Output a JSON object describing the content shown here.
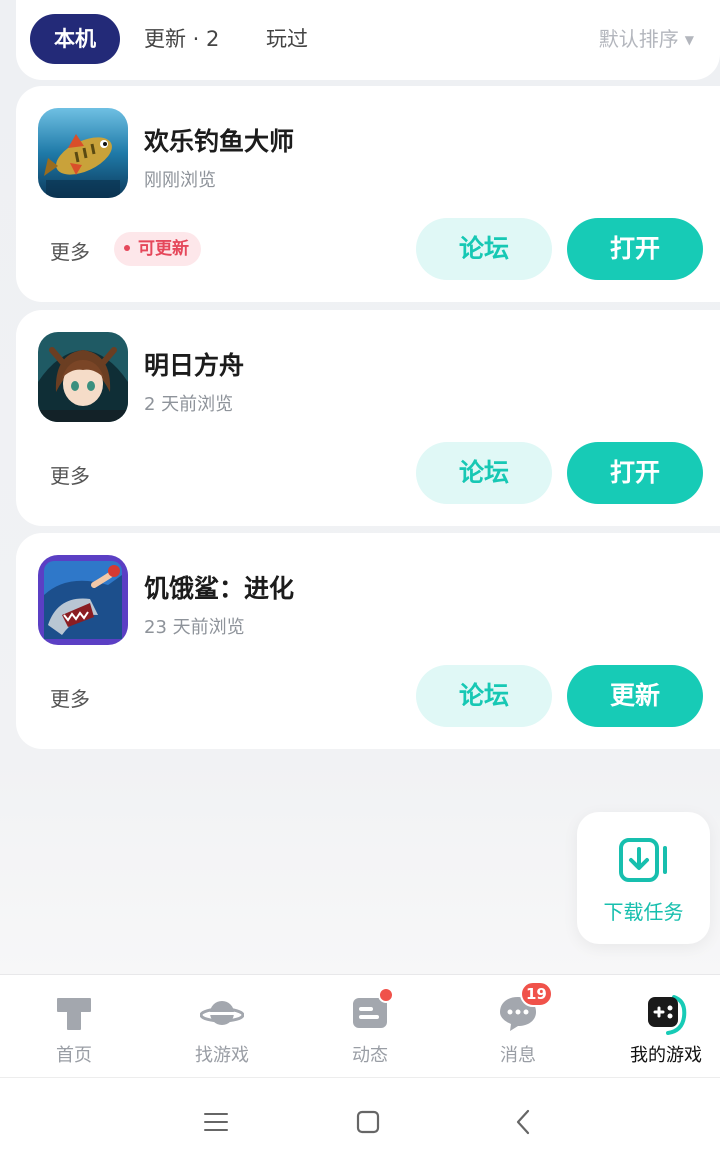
{
  "tabs": {
    "local": "本机",
    "updates": "更新 · 2",
    "played": "玩过",
    "sort_label": "默认排序"
  },
  "games": [
    {
      "name": "欢乐钓鱼大师",
      "subtitle": "刚刚浏览",
      "more": "更多",
      "badge": "可更新",
      "forum": "论坛",
      "action": "打开",
      "icon": "fishing-game-icon"
    },
    {
      "name": "明日方舟",
      "subtitle": "2 天前浏览",
      "more": "更多",
      "forum": "论坛",
      "action": "打开",
      "icon": "arknights-game-icon"
    },
    {
      "name": "饥饿鲨：进化",
      "subtitle": "23 天前浏览",
      "more": "更多",
      "forum": "论坛",
      "action": "更新",
      "icon": "hungry-shark-game-icon"
    }
  ],
  "download_task": {
    "label": "下载任务",
    "icon": "download-icon"
  },
  "nav": [
    {
      "label": "首页",
      "icon": "home-icon"
    },
    {
      "label": "找游戏",
      "icon": "planet-icon"
    },
    {
      "label": "动态",
      "icon": "feed-icon"
    },
    {
      "label": "消息",
      "icon": "chat-icon",
      "badge": "19"
    },
    {
      "label": "我的游戏",
      "icon": "gamepad-icon",
      "active": true
    }
  ],
  "colors": {
    "accent": "#17cbb6",
    "accent_light": "#e0f8f6",
    "active_tab": "#232a78",
    "badge_red": "#f0524a"
  }
}
